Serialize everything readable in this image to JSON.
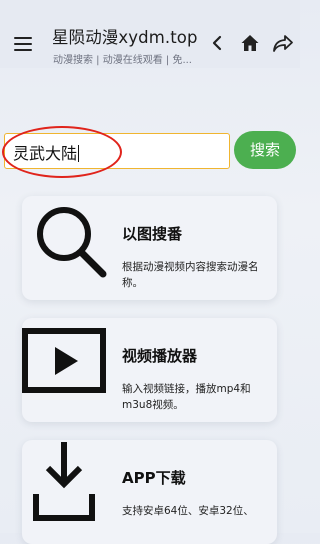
{
  "header": {
    "title": "星陨动漫xydm.top",
    "subtitle": "动漫搜索 | 动漫在线观看 | 免..."
  },
  "search": {
    "value": "灵武大陆",
    "button_label": "搜索"
  },
  "cards": [
    {
      "title": "以图搜番",
      "desc": "根据动漫视频内容搜索动漫名称。",
      "icon": "magnifier-icon"
    },
    {
      "title": "视频播放器",
      "desc": "输入视频链接，播放mp4和m3u8视频。",
      "icon": "play-icon"
    },
    {
      "title": "APP下载",
      "desc": "支持安卓64位、安卓32位、",
      "icon": "download-icon"
    }
  ],
  "colors": {
    "search_button": "#4caf50",
    "input_border": "#f0b530",
    "annotation": "#e0241c"
  }
}
